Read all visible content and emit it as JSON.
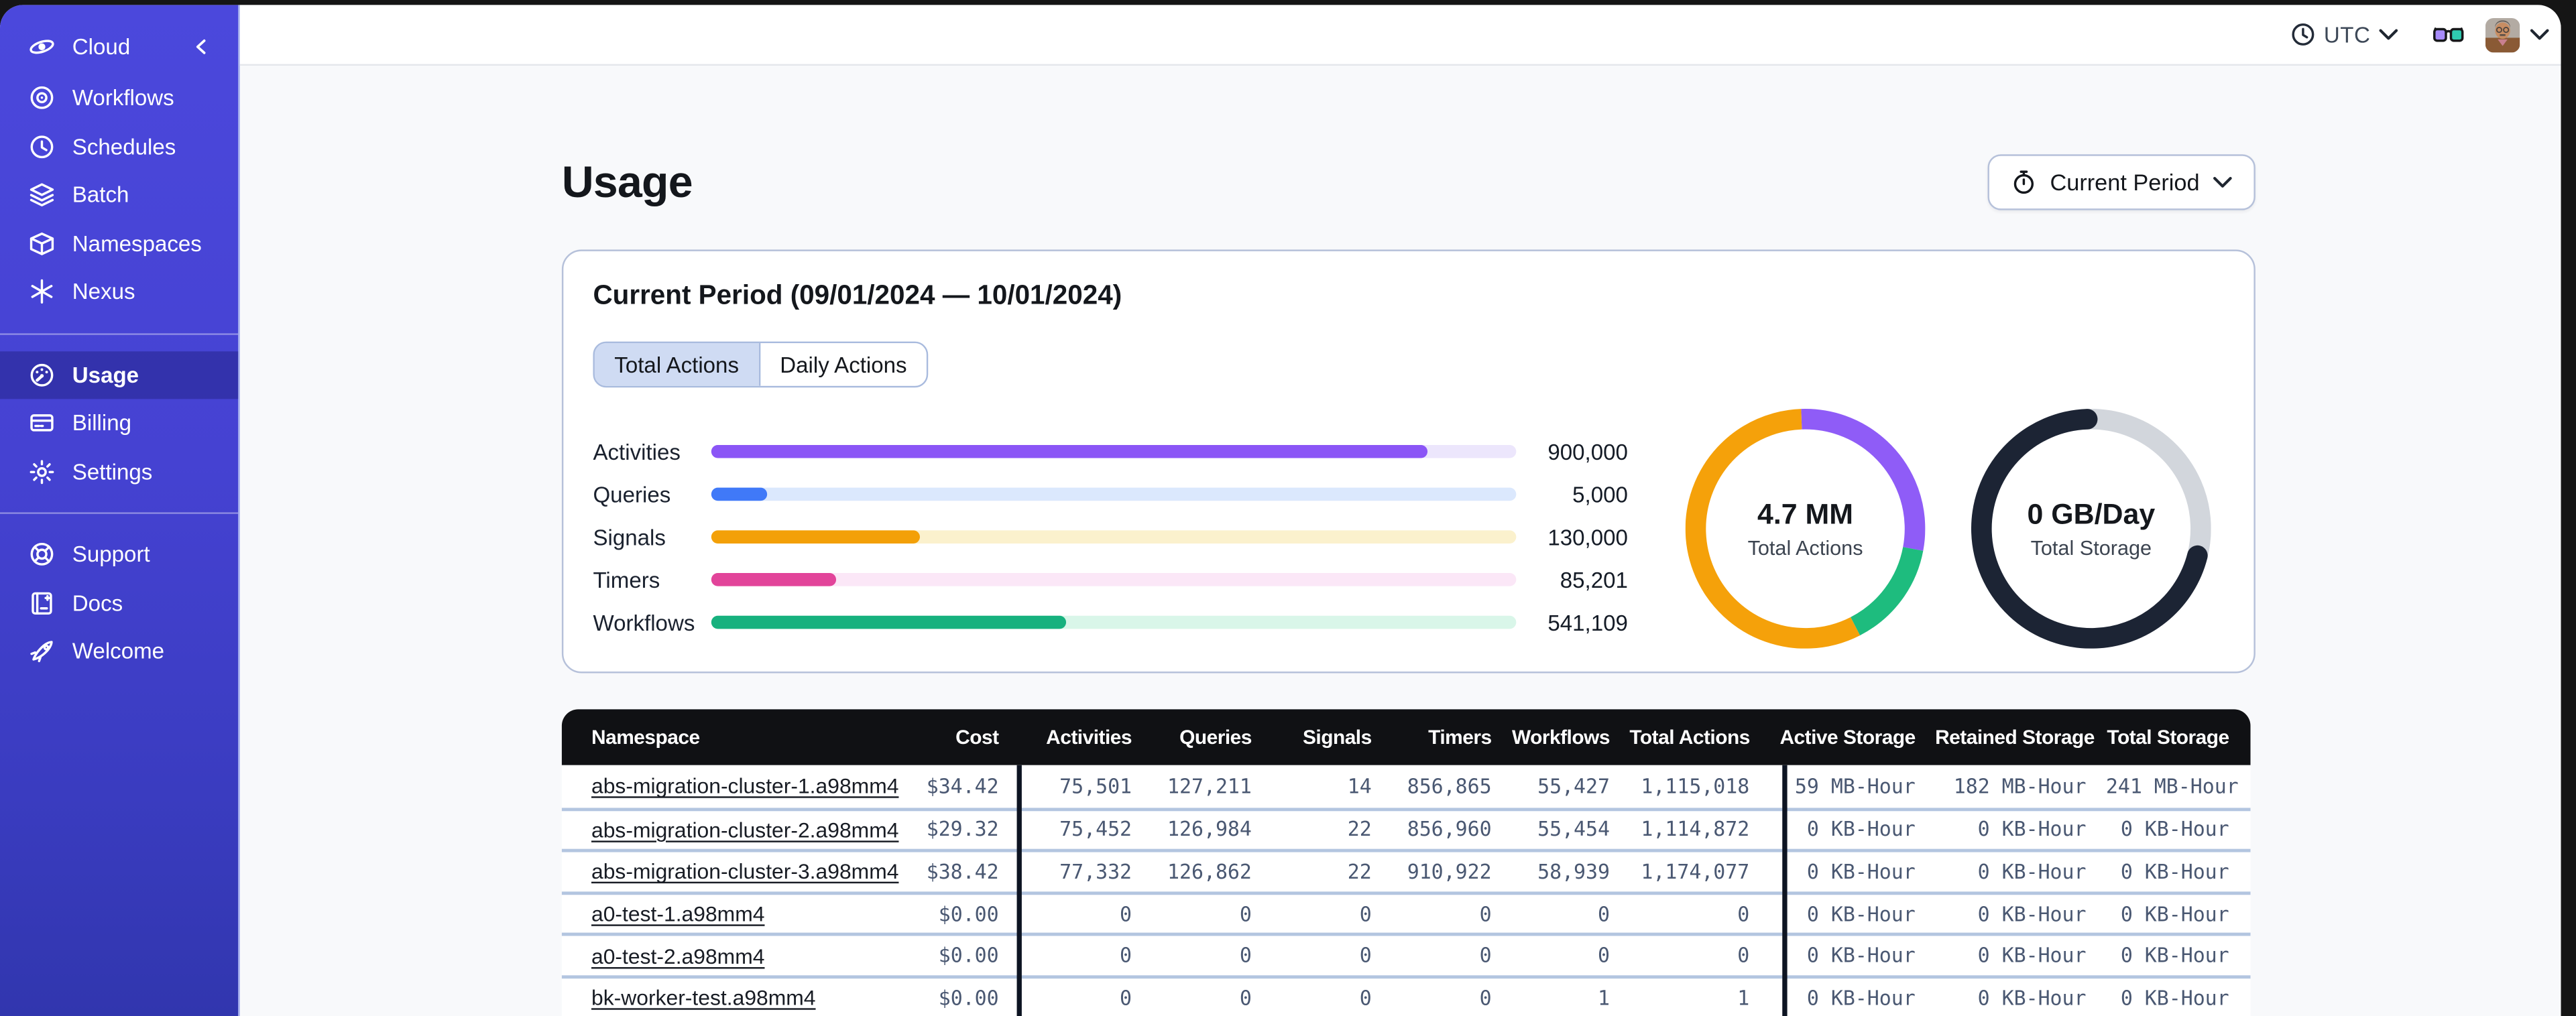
{
  "sidebar": {
    "brand": {
      "label": "Cloud",
      "icon": "cloud-logo",
      "collapse_icon": "chevron-left"
    },
    "groups": [
      {
        "items": [
          {
            "icon": "workflows",
            "label": "Workflows",
            "active": false
          },
          {
            "icon": "schedules",
            "label": "Schedules",
            "active": false
          },
          {
            "icon": "batch",
            "label": "Batch",
            "active": false
          },
          {
            "icon": "namespaces",
            "label": "Namespaces",
            "active": false
          },
          {
            "icon": "nexus",
            "label": "Nexus",
            "active": false
          }
        ]
      },
      {
        "items": [
          {
            "icon": "usage",
            "label": "Usage",
            "active": true
          },
          {
            "icon": "billing",
            "label": "Billing",
            "active": false
          },
          {
            "icon": "settings",
            "label": "Settings",
            "active": false
          }
        ]
      },
      {
        "items": [
          {
            "icon": "support",
            "label": "Support",
            "active": false
          },
          {
            "icon": "docs",
            "label": "Docs",
            "active": false
          },
          {
            "icon": "welcome",
            "label": "Welcome",
            "active": false
          }
        ]
      }
    ]
  },
  "header": {
    "timezone": "UTC",
    "icons": [
      "clock-icon",
      "chevron-down-icon",
      "glasses-icon",
      "user-avatar",
      "chevron-down-icon"
    ]
  },
  "page": {
    "title": "Usage",
    "period_button": {
      "icon": "stopwatch-icon",
      "label": "Current Period"
    }
  },
  "usage_card": {
    "title": "Current Period (09/01/2024 — 10/01/2024)",
    "tabs": [
      {
        "label": "Total Actions",
        "active": true
      },
      {
        "label": "Daily Actions",
        "active": false
      }
    ],
    "bars": [
      {
        "label": "Activities",
        "value": "900,000",
        "pct": 89,
        "color": "#8B55F6",
        "track": "#ECE6FC"
      },
      {
        "label": "Queries",
        "value": "5,000",
        "pct": 7,
        "color": "#4079F8",
        "track": "#DBE8FD"
      },
      {
        "label": "Signals",
        "value": "130,000",
        "pct": 26,
        "color": "#F3A008",
        "track": "#FBF1CD"
      },
      {
        "label": "Timers",
        "value": "85,201",
        "pct": 15.5,
        "color": "#E2449A",
        "track": "#FBE7F7"
      },
      {
        "label": "Workflows",
        "value": "541,109",
        "pct": 44,
        "color": "#17B17E",
        "track": "#D9F6E9"
      }
    ],
    "donuts": [
      {
        "value": "4.7 MM",
        "label": "Total Actions",
        "segments": [
          {
            "color": "#8F5CF7",
            "pct": 28.5
          },
          {
            "color": "#1EBC7E",
            "pct": 14.5
          },
          {
            "color": "#F5A10A",
            "pct": 57
          }
        ]
      },
      {
        "value": "0 GB/Day",
        "label": "Total Storage",
        "segments": [
          {
            "color": "#D2D6DC",
            "pct": 29.5
          },
          {
            "color": "#1C2434",
            "pct": 70.5
          }
        ]
      }
    ]
  },
  "table": {
    "columns": [
      "Namespace",
      "Cost",
      "Activities",
      "Queries",
      "Signals",
      "Timers",
      "Workflows",
      "Total Actions",
      "Active Storage",
      "Retained Storage",
      "Total Storage"
    ],
    "rows": [
      [
        "abs-migration-cluster-1.a98mm4",
        "$34.42",
        "75,501",
        "127,211",
        "14",
        "856,865",
        "55,427",
        "1,115,018",
        "59 MB-Hour",
        "182 MB-Hour",
        "241 MB-Hour"
      ],
      [
        "abs-migration-cluster-2.a98mm4",
        "$29.32",
        "75,452",
        "126,984",
        "22",
        "856,960",
        "55,454",
        "1,114,872",
        "0 KB-Hour",
        "0 KB-Hour",
        "0 KB-Hour"
      ],
      [
        "abs-migration-cluster-3.a98mm4",
        "$38.42",
        "77,332",
        "126,862",
        "22",
        "910,922",
        "58,939",
        "1,174,077",
        "0 KB-Hour",
        "0 KB-Hour",
        "0 KB-Hour"
      ],
      [
        "a0-test-1.a98mm4",
        "$0.00",
        "0",
        "0",
        "0",
        "0",
        "0",
        "0",
        "0 KB-Hour",
        "0 KB-Hour",
        "0 KB-Hour"
      ],
      [
        "a0-test-2.a98mm4",
        "$0.00",
        "0",
        "0",
        "0",
        "0",
        "0",
        "0",
        "0 KB-Hour",
        "0 KB-Hour",
        "0 KB-Hour"
      ],
      [
        "bk-worker-test.a98mm4",
        "$0.00",
        "0",
        "0",
        "0",
        "0",
        "1",
        "1",
        "0 KB-Hour",
        "0 KB-Hour",
        "0 KB-Hour"
      ]
    ]
  },
  "chart_data": [
    {
      "type": "bar",
      "title": "Total Actions by type",
      "categories": [
        "Activities",
        "Queries",
        "Signals",
        "Timers",
        "Workflows"
      ],
      "values": [
        900000,
        5000,
        130000,
        85201,
        541109
      ],
      "xlabel": "",
      "ylabel": "",
      "legend": "none",
      "grid": false
    },
    {
      "type": "pie",
      "title": "Total Actions donut",
      "center_value": "4.7 MM",
      "center_label": "Total Actions",
      "slices_pct": [
        28.5,
        14.5,
        57
      ],
      "colors": [
        "#8F5CF7",
        "#1EBC7E",
        "#F5A10A"
      ]
    },
    {
      "type": "pie",
      "title": "Total Storage donut",
      "center_value": "0 GB/Day",
      "center_label": "Total Storage",
      "slices_pct": [
        29.5,
        70.5
      ],
      "colors": [
        "#D2D6DC",
        "#1C2434"
      ]
    }
  ]
}
